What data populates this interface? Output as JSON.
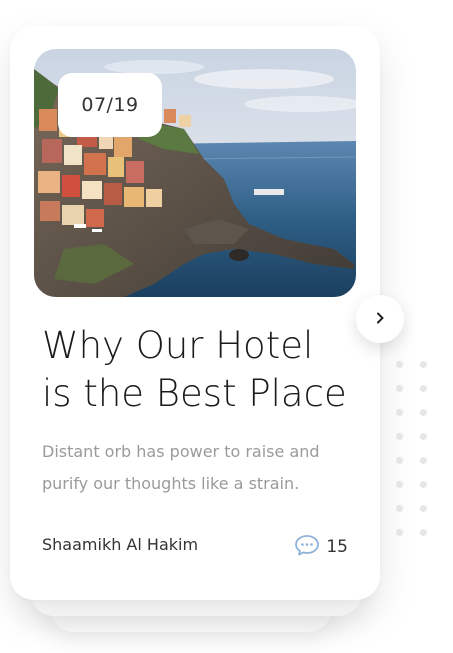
{
  "post": {
    "date": "07/19",
    "title_line1": "Why Our Hotel",
    "title_line2": "is the Best Place",
    "excerpt": "Distant orb has power to raise and purify our thoughts like a strain.",
    "author": "Shaamikh Al Hakim",
    "comment_count": "15",
    "image_icon": "coastal-village-photo",
    "comment_icon": "speech-bubble-icon",
    "next_icon": "chevron-right-icon"
  },
  "colors": {
    "accent_icon": "#8fb3d9",
    "title": "#1b1b1b",
    "muted_text": "#9a9a9a",
    "body_text": "#333333",
    "dot": "#e6e6e6"
  }
}
